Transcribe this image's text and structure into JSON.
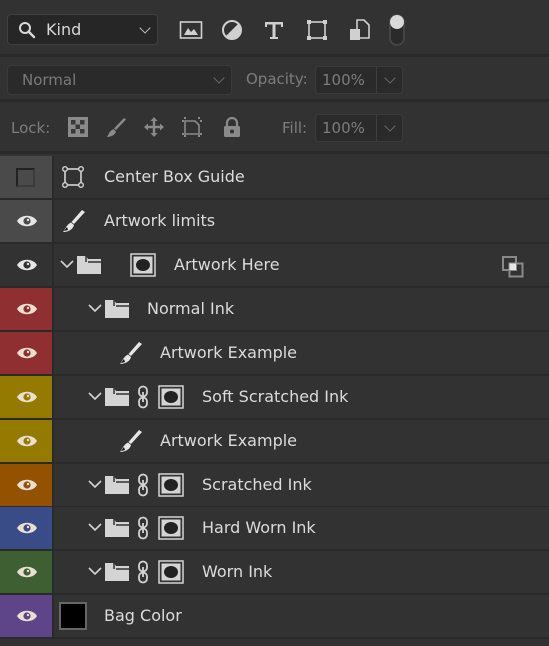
{
  "filter": {
    "kind_label": "Kind",
    "icons": [
      "pixel-layer-filter-icon",
      "adjustment-layer-filter-icon",
      "type-layer-filter-icon",
      "shape-layer-filter-icon",
      "smart-object-filter-icon",
      "filter-toggle-icon"
    ]
  },
  "blend": {
    "mode": "Normal",
    "opacity_label": "Opacity:",
    "opacity_value": "100%"
  },
  "lock": {
    "label": "Lock:",
    "icons": [
      "lock-transparent-pixels-icon",
      "lock-image-pixels-icon",
      "lock-position-icon",
      "lock-artboard-icon",
      "lock-all-icon"
    ],
    "fill_label": "Fill:",
    "fill_value": "100%"
  },
  "layers": [
    {
      "name": "Center Box Guide",
      "visible": false,
      "color": "#4a4a4a",
      "type": "shape"
    },
    {
      "name": "Artwork limits",
      "visible": true,
      "color": "#4a4a4a",
      "type": "brush"
    },
    {
      "name": "Artwork Here",
      "visible": true,
      "color": "#323232",
      "type": "group-mask",
      "smart_filter_badge": true
    },
    {
      "name": "Normal Ink",
      "visible": true,
      "color": "#8f2f31",
      "type": "group"
    },
    {
      "name": "Artwork Example",
      "visible": true,
      "color": "#8f2f31",
      "type": "brush"
    },
    {
      "name": "Soft Scratched Ink",
      "visible": true,
      "color": "#957a00",
      "type": "group-link-mask"
    },
    {
      "name": "Artwork Example",
      "visible": true,
      "color": "#957a00",
      "type": "brush"
    },
    {
      "name": "Scratched Ink",
      "visible": true,
      "color": "#945200",
      "type": "group-link-mask"
    },
    {
      "name": "Hard Worn Ink",
      "visible": true,
      "color": "#3a4c87",
      "type": "group-link-mask"
    },
    {
      "name": "Worn Ink",
      "visible": true,
      "color": "#3d5f31",
      "type": "group-link-mask"
    },
    {
      "name": "Bag Color",
      "visible": true,
      "color": "#5e4488",
      "type": "fill",
      "swatch": "#000000"
    }
  ]
}
